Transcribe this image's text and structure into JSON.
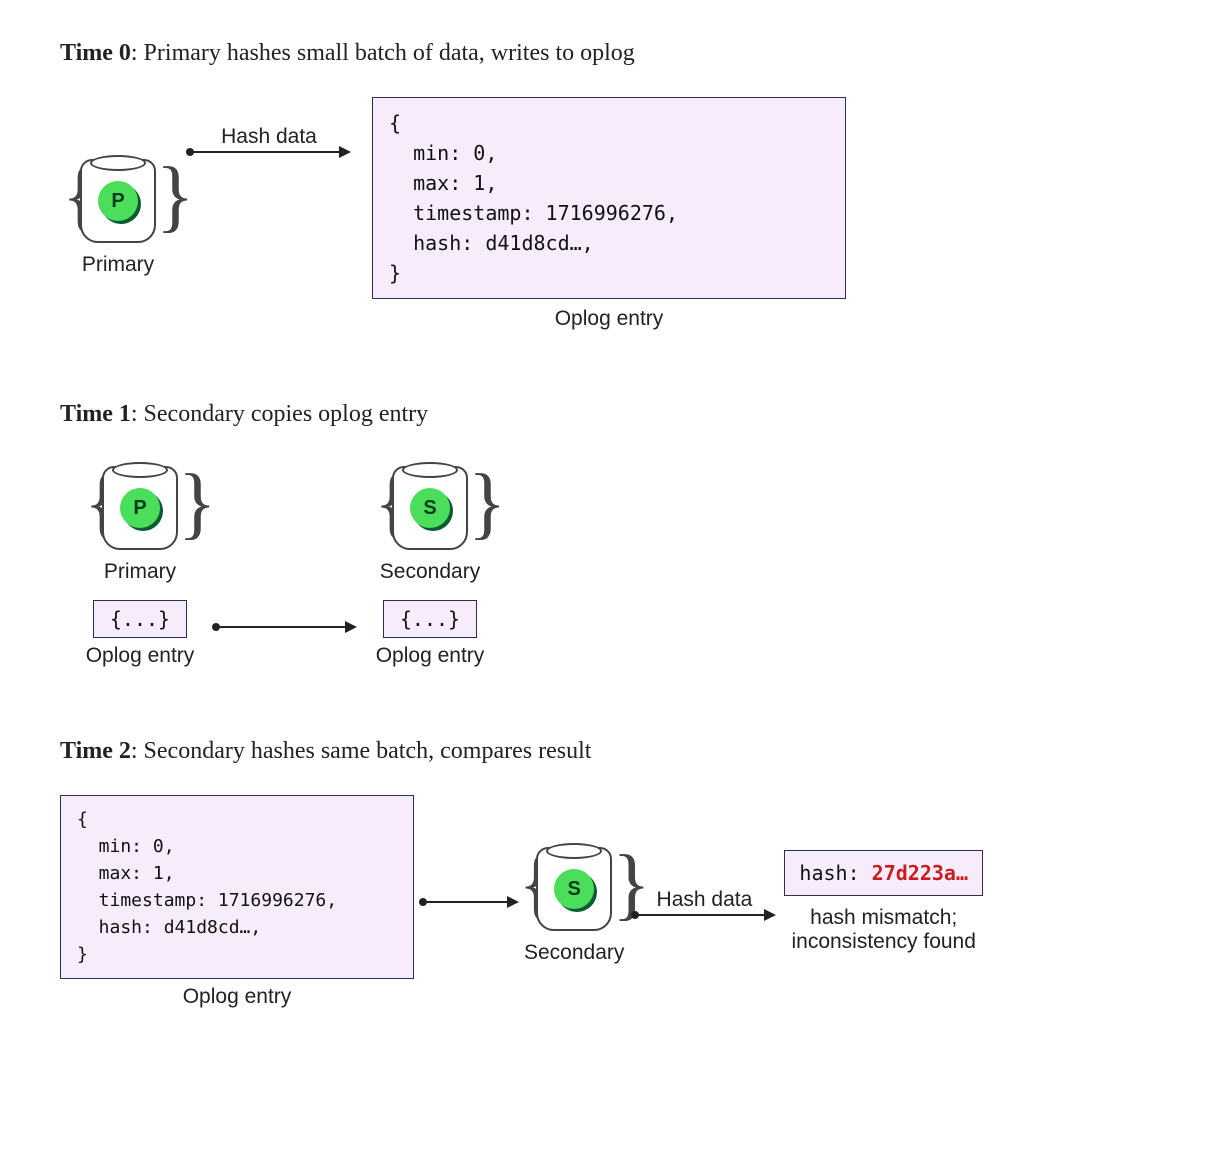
{
  "time0": {
    "title_bold": "Time 0",
    "title_rest": ": Primary hashes small batch of data, writes to oplog",
    "node_letter": "P",
    "node_label": "Primary",
    "arrow_label": "Hash data",
    "oplog_code": "{\n  min: 0,\n  max: 1,\n  timestamp: 1716996276,\n  hash: d41d8cd…,\n}",
    "oplog_label": "Oplog entry"
  },
  "time1": {
    "title_bold": "Time 1",
    "title_rest": ": Secondary copies oplog entry",
    "primary_letter": "P",
    "primary_label": "Primary",
    "secondary_letter": "S",
    "secondary_label": "Secondary",
    "box_text": "{...}",
    "oplog_label": "Oplog entry"
  },
  "time2": {
    "title_bold": "Time 2",
    "title_rest": ": Secondary hashes same batch, compares result",
    "oplog_code": "{\n  min: 0,\n  max: 1,\n  timestamp: 1716996276,\n  hash: d41d8cd…,\n}",
    "oplog_label": "Oplog entry",
    "node_letter": "S",
    "node_label": "Secondary",
    "arrow_label": "Hash data",
    "hash_prefix": "hash: ",
    "hash_value": "27d223a…",
    "mismatch_line1": "hash mismatch;",
    "mismatch_line2": "inconsistency found"
  }
}
